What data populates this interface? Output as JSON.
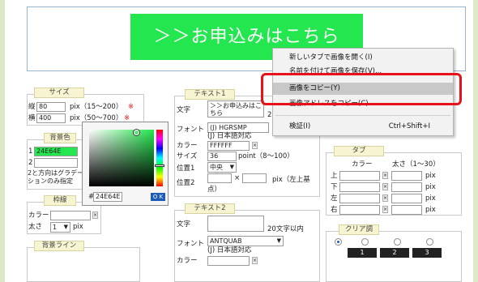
{
  "preview": {
    "button_text": "＞＞お申込みはこちら",
    "button_color": "#24e64e"
  },
  "context_menu": {
    "items": [
      {
        "label": "新しいタブで画像を開く(I)",
        "shortcut": ""
      },
      {
        "label": "名前を付けて画像を保存(V)...",
        "shortcut": ""
      },
      {
        "label": "画像をコピー(Y)",
        "shortcut": ""
      },
      {
        "label": "画像アドレスをコピー(C)",
        "shortcut": ""
      },
      {
        "label": "検証(I)",
        "shortcut": "Ctrl+Shift+I"
      }
    ],
    "highlight_color": "#e8101a"
  },
  "size": {
    "legend": "サイズ",
    "height_label": "縦",
    "height_value": "80",
    "height_range": "pix（15〜200）",
    "height_mark": "※",
    "width_label": "横",
    "width_value": "400",
    "width_range": "pix（50〜700）",
    "width_mark": "※"
  },
  "bgcolor": {
    "legend": "背景色",
    "row1_label": "1",
    "row1_value": "24E64E",
    "row2_label": "2",
    "note": "2と方向はグラデーションのみ指定"
  },
  "picker": {
    "hex_prefix": "#",
    "hex_value": "24E64E",
    "ok_label": "O K"
  },
  "border": {
    "legend": "枠線",
    "color_label": "カラー",
    "thick_label": "太さ",
    "thick_value": "1",
    "unit": "pix"
  },
  "bgline": {
    "legend": "背景ライン"
  },
  "text1": {
    "legend": "テキスト1",
    "text_label": "文字",
    "text_value": "＞＞お申込みはこちら",
    "text_suffix": "2",
    "font_label": "フォント",
    "font_value": "(J) HGRSMP",
    "font_sub": "(J) 日本語対応",
    "color_label": "カラー",
    "color_value": "FFFFFF",
    "size_label": "サイズ",
    "size_value": "36",
    "size_range": "point（8〜100）",
    "pos1_label": "位置1",
    "pos1_value": "中央",
    "pos2_label": "位置2",
    "pos2_unit": "pix（左上基点）"
  },
  "text2": {
    "legend": "テキスト2",
    "text_label": "文字",
    "text_limit": "20文字以内",
    "font_label": "フォント",
    "font_value": "ANTQUAB",
    "font_sub": "(J) 日本語対応",
    "color_label": "カラー"
  },
  "tab": {
    "legend": "タブ",
    "col_color": "カラー",
    "col_thick": "太さ（1〜30）",
    "rows": [
      {
        "label": "上",
        "unit": "pix"
      },
      {
        "label": "下",
        "unit": "pix"
      },
      {
        "label": "左",
        "unit": "pix"
      },
      {
        "label": "右",
        "unit": "pix"
      }
    ]
  },
  "clear": {
    "legend": "クリア調",
    "dark_labels": [
      "1",
      "2",
      "3"
    ]
  }
}
